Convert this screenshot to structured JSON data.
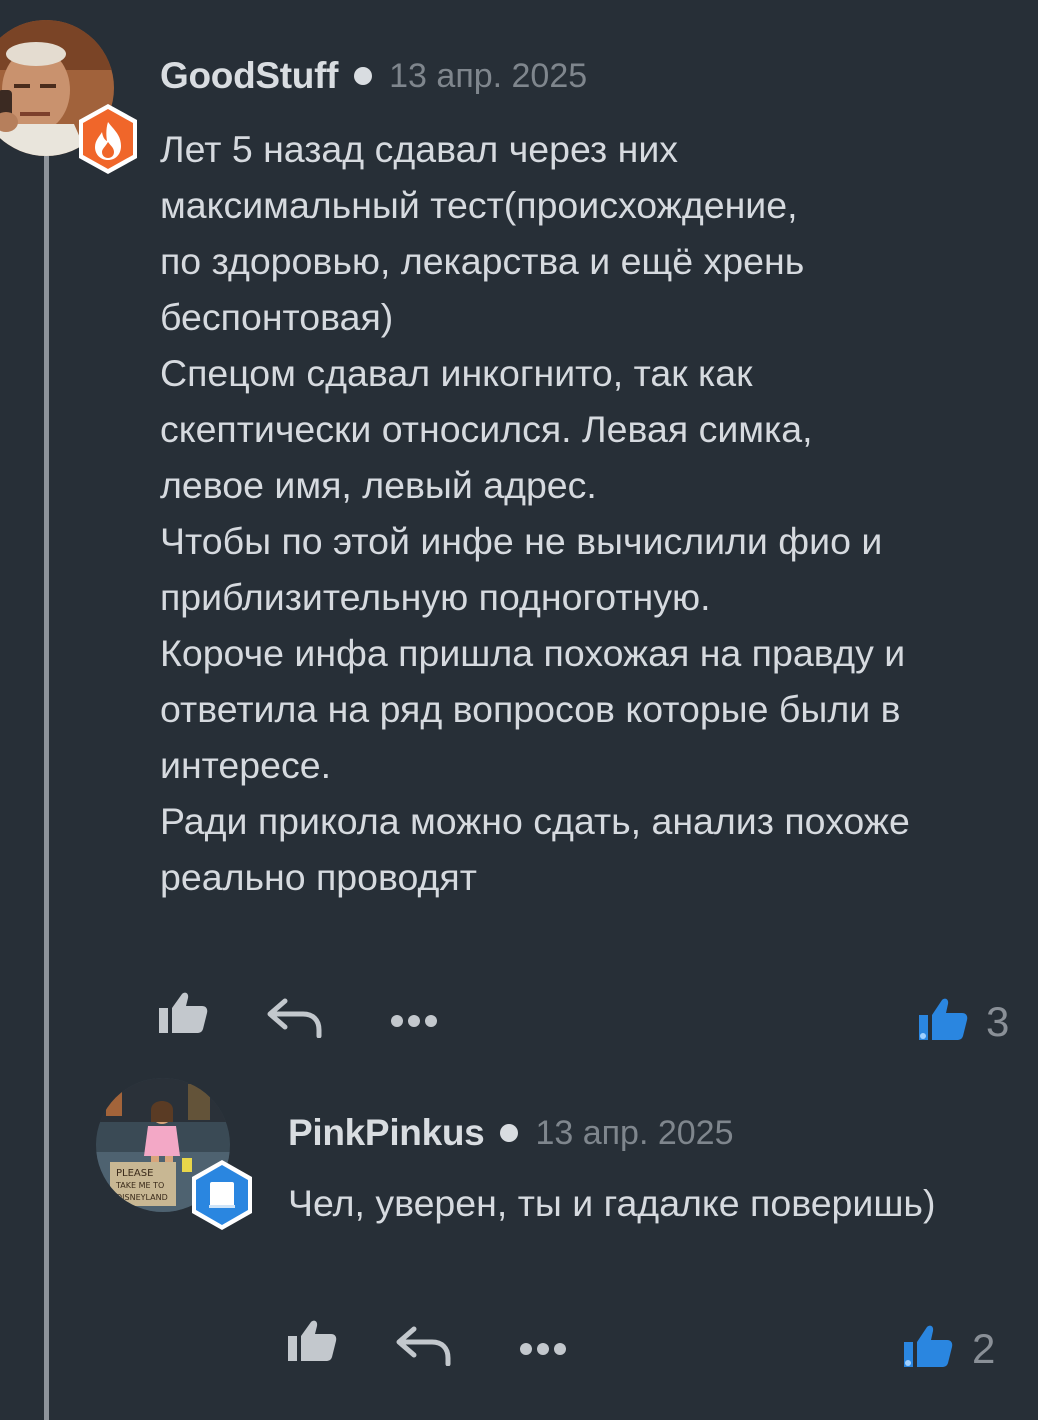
{
  "comments": [
    {
      "username": "GoodStuff",
      "date": "13 апр. 2025",
      "text_lines": [
        "Лет 5 назад сдавал через них",
        "максимальный тест(происхождение,",
        "по здоровью, лекарства и ещё хрень",
        "беспонтовая)",
        "Спецом сдавал инкогнито, так как",
        "скептически относился. Левая симка,",
        "левое имя, левый адрес.",
        "Чтобы по этой инфе не вычислили  фио и",
        "приблизительную подноготную.",
        "Короче инфа пришла похожая на правду и",
        "ответила на ряд вопросов которые были в",
        "интересе.",
        "Ради прикола можно сдать, анализ похоже",
        "реально проводят"
      ],
      "rating": "3",
      "badge_icon": "flame-icon",
      "badge_color": "#f0662a"
    },
    {
      "username": "PinkPinkus",
      "date": "13 апр. 2025",
      "text": "Чел, уверен, ты и гадалке поверишь)",
      "rating": "2",
      "badge_icon": "book-icon",
      "badge_color": "#2a86e0",
      "avatar_sign": [
        "PLEASE",
        "TAKE ME TO",
        "DISNEYLAND"
      ]
    }
  ],
  "icons": {
    "like": "thumbs-up-icon",
    "reply": "reply-arrow-icon",
    "more": "more-dots-icon",
    "rating": "thumbs-up-filled-icon"
  },
  "colors": {
    "background": "#272f37",
    "text": "#d6dadf",
    "muted": "#7f868d",
    "accent": "#2a86e0"
  }
}
